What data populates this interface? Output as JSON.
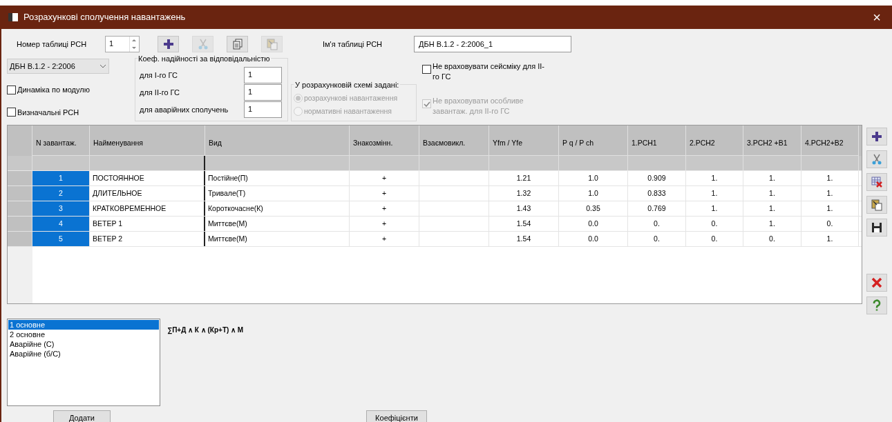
{
  "window": {
    "title": "Розрахункові сполучення навантажень",
    "close": "×"
  },
  "table_number": {
    "label": "Номер таблиці РСН",
    "value": "1"
  },
  "top_toolbar": [
    {
      "kind": "add",
      "disabled": false
    },
    {
      "kind": "cut",
      "disabled": true
    },
    {
      "kind": "copy",
      "disabled": false
    },
    {
      "kind": "paste",
      "disabled": true
    }
  ],
  "table_name": {
    "label": "Ім'я таблиці РСН",
    "value": "ДБН В.1.2 - 2:2006_1"
  },
  "norm_select": {
    "value": "ДБН В.1.2 - 2:2006"
  },
  "left_checks": [
    {
      "label": "Динаміка по модулю",
      "checked": false
    },
    {
      "label": "Визначальні РСН",
      "checked": false
    }
  ],
  "reliability": {
    "title": "Коеф. надійності за відповідальністю",
    "fields": [
      {
        "label": "для I-го ГС",
        "value": "1"
      },
      {
        "label": "для II-го ГС",
        "value": "1"
      },
      {
        "label": "для аварійних сполучень",
        "value": "1"
      }
    ]
  },
  "scheme": {
    "title": "У розрахунковій схемі задані:",
    "disabled": true,
    "options": [
      {
        "label": "розрахункові навантаження",
        "selected": true
      },
      {
        "label": "нормативні навантаження",
        "selected": false
      }
    ]
  },
  "right_checks": [
    {
      "label": "Не враховувати сейсміку для II-го ГС",
      "checked": false,
      "disabled": false
    },
    {
      "label": "Не враховувати особливе завантаж. для II-го ГС",
      "checked": true,
      "disabled": true
    }
  ],
  "table": {
    "columns": [
      "N завантаж.",
      "Найменування",
      "Вид",
      "Знакозмінн.",
      "Взаємовикл.",
      "Yfm / Yfe",
      "P q / P ch",
      "1.РСН1",
      "2.РСН2",
      "3.РСН2 +В1",
      "4.РСН2+В2"
    ],
    "rows": [
      {
        "selected": true,
        "cells": [
          "1",
          "ПОСТОЯННОЕ",
          "Постійне(П)",
          "+",
          "",
          "1.21",
          "1.0",
          "0.909",
          "1.",
          "1.",
          "1."
        ]
      },
      {
        "selected": true,
        "cells": [
          "2",
          "ДЛИТЕЛЬНОЕ",
          "Тривале(Т)",
          "+",
          "",
          "1.32",
          "1.0",
          "0.833",
          "1.",
          "1.",
          "1."
        ]
      },
      {
        "selected": true,
        "cells": [
          "3",
          "КРАТКОВРЕМЕННОЕ",
          "Короткочасне(К)",
          "+",
          "",
          "1.43",
          "0.35",
          "0.769",
          "1.",
          "1.",
          "1."
        ]
      },
      {
        "selected": true,
        "cells": [
          "4",
          "ВЕТЕР 1",
          "Миттєве(М)",
          "+",
          "",
          "1.54",
          "0.0",
          "0.",
          "0.",
          "1.",
          "0."
        ]
      },
      {
        "selected": true,
        "cells": [
          "5",
          "ВЕТЕР 2",
          "Миттєве(М)",
          "+",
          "",
          "1.54",
          "0.0",
          "0.",
          "0.",
          "0.",
          "1."
        ]
      }
    ]
  },
  "side_toolbar": [
    {
      "kind": "add",
      "disabled": false
    },
    {
      "kind": "cut",
      "disabled": false
    },
    {
      "kind": "delete-table",
      "disabled": false
    },
    {
      "kind": "paste",
      "disabled": false
    },
    {
      "kind": "save",
      "disabled": false
    },
    {
      "kind": "spacer"
    },
    {
      "kind": "delete",
      "disabled": false
    },
    {
      "kind": "help",
      "disabled": false
    }
  ],
  "combinations": [
    {
      "label": "1 основне",
      "selected": true
    },
    {
      "label": "2 основне",
      "selected": false
    },
    {
      "label": "Аварійне (С)",
      "selected": false
    },
    {
      "label": "Аварійне (б/С)",
      "selected": false
    }
  ],
  "formula": "∑П+Д ∧ К ∧ (Кр+Т) ∧ М",
  "buttons": {
    "add": "Додати",
    "coefficients": "Коефіцієнти"
  }
}
